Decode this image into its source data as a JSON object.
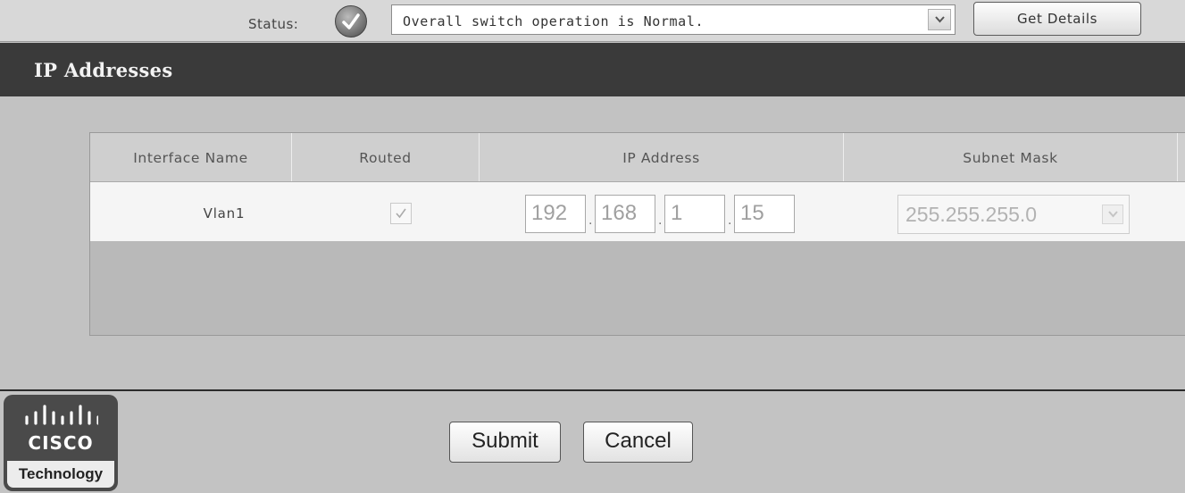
{
  "statusbar": {
    "label": "Status:",
    "status_icon": "check-circle-icon",
    "selected_status": "Overall switch operation is Normal.",
    "get_details_label": "Get Details"
  },
  "section": {
    "title": "IP Addresses"
  },
  "table": {
    "columns": [
      "Interface Name",
      "Routed",
      "IP Address",
      "Subnet Mask"
    ],
    "rows": [
      {
        "interface_name": "Vlan1",
        "routed": true,
        "ip_octets": [
          "192",
          "168",
          "1",
          "15"
        ],
        "subnet_mask": "255.255.255.0"
      }
    ]
  },
  "footer": {
    "logo_text": "CISCO",
    "logo_subtext": "Technology",
    "submit_label": "Submit",
    "cancel_label": "Cancel"
  },
  "colors": {
    "header_bar": "#3a3a3a",
    "background": "#c4c4c4"
  }
}
